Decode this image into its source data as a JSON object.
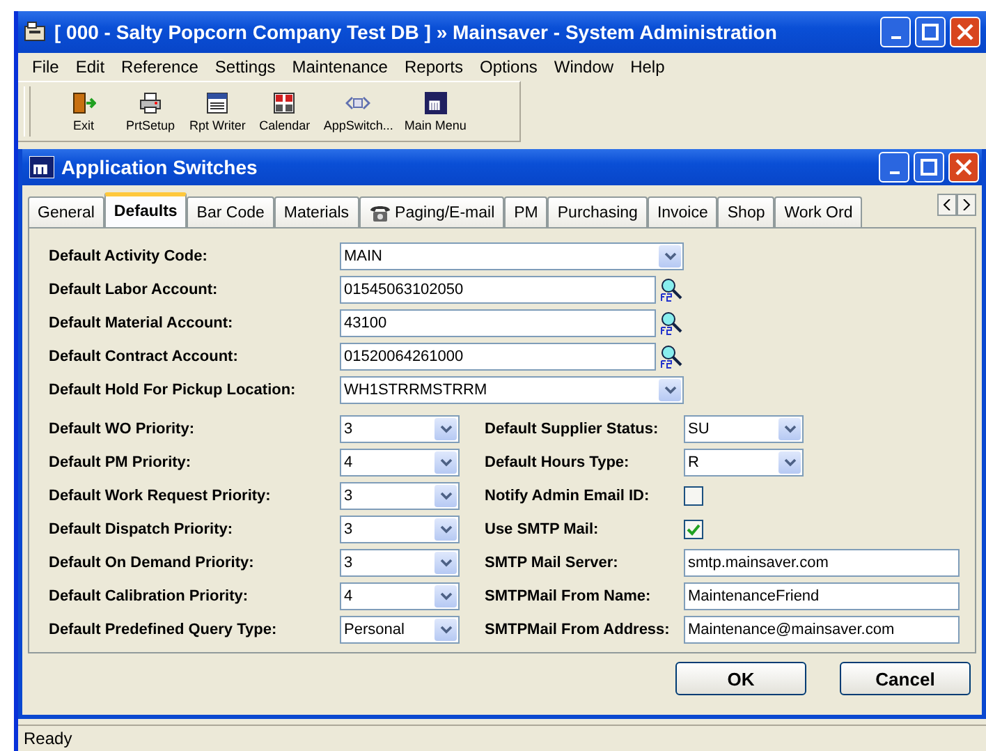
{
  "window": {
    "title": "[ 000 - Salty Popcorn Company Test DB ] » Mainsaver - System Administration"
  },
  "menu": [
    "File",
    "Edit",
    "Reference",
    "Settings",
    "Maintenance",
    "Reports",
    "Options",
    "Window",
    "Help"
  ],
  "toolbar": [
    "Exit",
    "PrtSetup",
    "Rpt Writer",
    "Calendar",
    "AppSwitch...",
    "Main Menu"
  ],
  "dialog": {
    "title": "Application Switches",
    "tabs": [
      {
        "label": "General",
        "selected": false,
        "kind": "text"
      },
      {
        "label": "Defaults",
        "selected": true,
        "kind": "text"
      },
      {
        "label": "Bar Code",
        "selected": false,
        "kind": "text"
      },
      {
        "label": "Materials",
        "selected": false,
        "kind": "text"
      },
      {
        "label": "Paging/E-mail",
        "selected": false,
        "kind": "icon"
      },
      {
        "label": "PM",
        "selected": false,
        "kind": "text"
      },
      {
        "label": "Purchasing",
        "selected": false,
        "kind": "text"
      },
      {
        "label": "Invoice",
        "selected": false,
        "kind": "text"
      },
      {
        "label": "Shop",
        "selected": false,
        "kind": "text"
      },
      {
        "label": "Work Ord",
        "selected": false,
        "kind": "text"
      }
    ],
    "fields": [
      {
        "label": "Default Activity Code:",
        "kind": "dropdown",
        "value": "MAIN"
      },
      {
        "label": "Default Labor Account:",
        "kind": "lookup",
        "value": "01545063102050"
      },
      {
        "label": "Default Material Account:",
        "kind": "lookup",
        "value": "43100"
      },
      {
        "label": "Default Contract Account:",
        "kind": "lookup",
        "value": "01520064261000"
      },
      {
        "label": "Default Hold For Pickup Location:",
        "kind": "dropdown",
        "value": "WH1STRRMSTRRM"
      }
    ],
    "left_fields": [
      {
        "label": "Default WO Priority:",
        "value": "3"
      },
      {
        "label": "Default PM Priority:",
        "value": "4"
      },
      {
        "label": "Default Work Request Priority:",
        "value": "3"
      },
      {
        "label": "Default Dispatch Priority:",
        "value": "3"
      },
      {
        "label": "Default On Demand Priority:",
        "value": "3"
      },
      {
        "label": "Default Calibration Priority:",
        "value": "4"
      },
      {
        "label": "Default Predefined Query Type:",
        "value": "Personal"
      }
    ],
    "right_fields": [
      {
        "label": "Default Supplier Status:",
        "kind": "dropdown",
        "value": "SU"
      },
      {
        "label": "Default Hours Type:",
        "kind": "dropdown",
        "value": "R"
      },
      {
        "label": "Notify Admin Email ID:",
        "kind": "checkbox",
        "checked": false
      },
      {
        "label": "Use SMTP Mail:",
        "kind": "checkbox",
        "checked": true
      },
      {
        "label": "SMTP Mail Server:",
        "kind": "text",
        "value": "smtp.mainsaver.com"
      },
      {
        "label": "SMTPMail From Name:",
        "kind": "text",
        "value": "MaintenanceFriend"
      },
      {
        "label": "SMTPMail From Address:",
        "kind": "text",
        "value": "Maintenance@mainsaver.com"
      }
    ],
    "buttons": [
      "OK",
      "Cancel"
    ]
  },
  "status_bar": "Ready"
}
